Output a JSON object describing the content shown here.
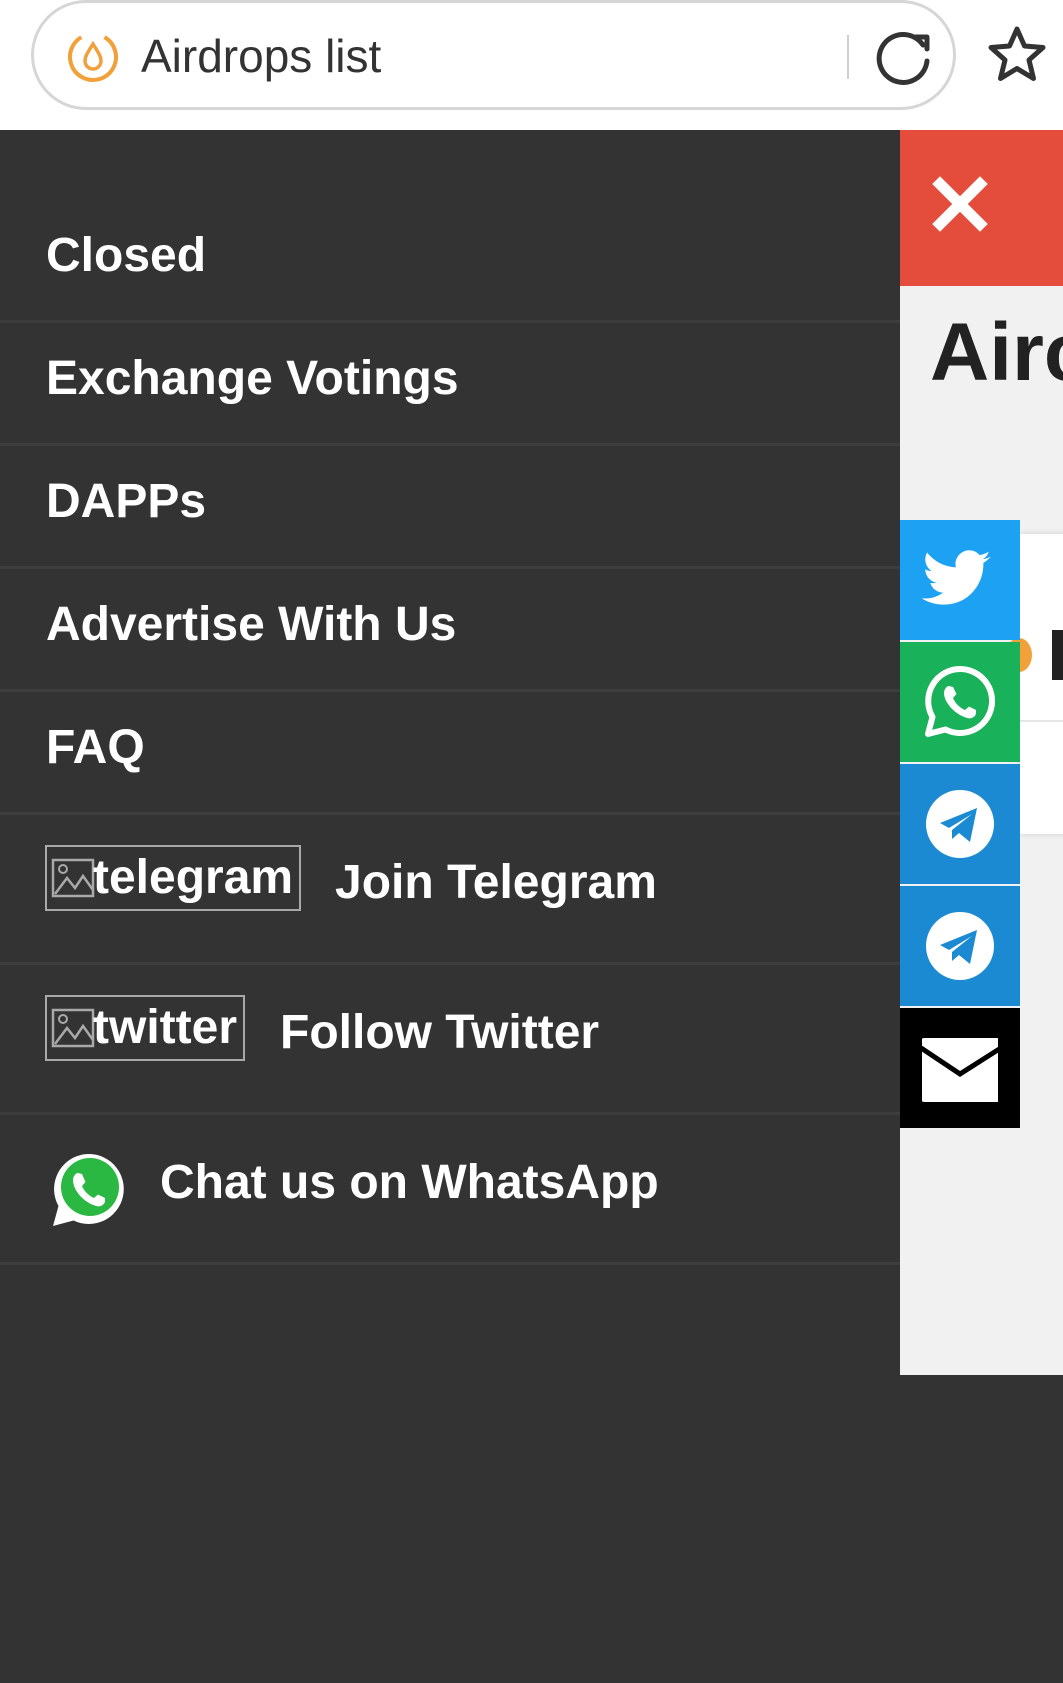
{
  "browser": {
    "page_title": "Airdrops list",
    "site_icon": "airdrop-droplet-icon",
    "reload_icon": "reload-icon",
    "bookmark_icon": "star-icon"
  },
  "background_page": {
    "heading_fragment": "Airc"
  },
  "drawer": {
    "close_icon": "close-icon",
    "menu_items": [
      {
        "label": "Closed"
      },
      {
        "label": "Exchange Votings"
      },
      {
        "label": "DAPPs"
      },
      {
        "label": "Advertise With Us"
      },
      {
        "label": "FAQ"
      }
    ],
    "social_links": {
      "telegram": {
        "image_alt": "telegram",
        "label": "Join Telegram"
      },
      "twitter": {
        "image_alt": "twitter",
        "label": "Follow Twitter"
      },
      "whatsapp": {
        "label": "Chat us on WhatsApp",
        "icon": "whatsapp-icon"
      }
    }
  },
  "share_bar": {
    "buttons": [
      {
        "icon": "twitter-icon",
        "color": "#1da1f2"
      },
      {
        "icon": "whatsapp-icon",
        "color": "#1ab15b"
      },
      {
        "icon": "telegram-icon",
        "color": "#1b8ad2"
      },
      {
        "icon": "telegram-icon",
        "color": "#1b8ad2"
      },
      {
        "icon": "email-icon",
        "color": "#000000"
      }
    ]
  },
  "colors": {
    "drawer_bg": "#333333",
    "close_button": "#e44c3b",
    "accent_orange": "#f2a13a"
  }
}
